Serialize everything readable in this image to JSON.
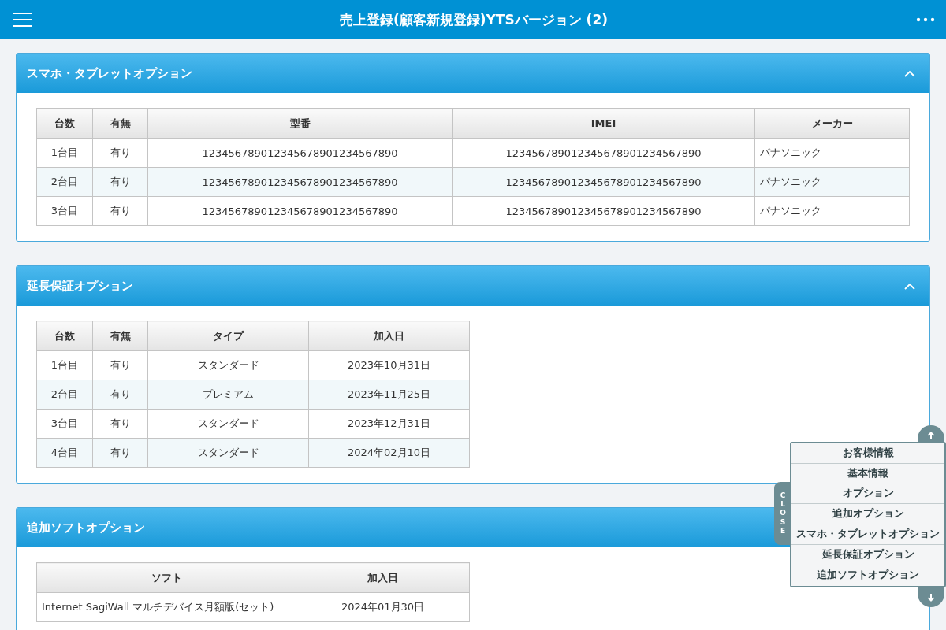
{
  "header": {
    "title": "売上登録(顧客新規登録)YTSバージョン (2)"
  },
  "sections": [
    {
      "title": "スマホ・タブレットオプション",
      "expanded": true,
      "columns": [
        "台数",
        "有無",
        "型番",
        "IMEI",
        "メーカー"
      ],
      "rows": [
        [
          "1台目",
          "有り",
          "123456789012345678901234567890",
          "123456789012345678901234567890",
          "パナソニック"
        ],
        [
          "2台目",
          "有り",
          "123456789012345678901234567890",
          "123456789012345678901234567890",
          "パナソニック"
        ],
        [
          "3台目",
          "有り",
          "123456789012345678901234567890",
          "123456789012345678901234567890",
          "パナソニック"
        ]
      ]
    },
    {
      "title": "延長保証オプション",
      "expanded": true,
      "columns": [
        "台数",
        "有無",
        "タイプ",
        "加入日"
      ],
      "rows": [
        [
          "1台目",
          "有り",
          "スタンダード",
          "2023年10月31日"
        ],
        [
          "2台目",
          "有り",
          "プレミアム",
          "2023年11月25日"
        ],
        [
          "3台目",
          "有り",
          "スタンダード",
          "2023年12月31日"
        ],
        [
          "4台目",
          "有り",
          "スタンダード",
          "2024年02月10日"
        ]
      ]
    },
    {
      "title": "追加ソフトオプション",
      "expanded": true,
      "columns": [
        "ソフト",
        "加入日"
      ],
      "rows": [
        [
          "Internet SagiWall マルチデバイス月額版(セット)",
          "2024年01月30日"
        ]
      ]
    }
  ],
  "side_nav": {
    "close_label": "CLOSE",
    "items": [
      "お客様情報",
      "基本情報",
      "オプション",
      "追加オプション",
      "スマホ・タブレットオプション",
      "延長保証オプション",
      "追加ソフトオプション"
    ]
  }
}
